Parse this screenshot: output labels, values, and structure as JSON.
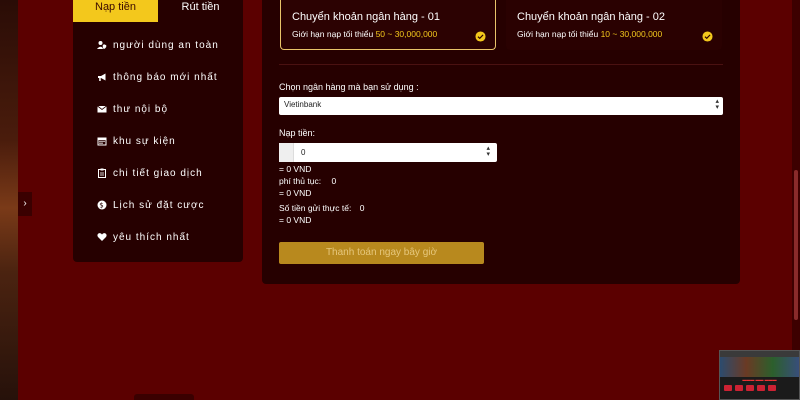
{
  "tabs": {
    "deposit": "Nạp tiền",
    "withdraw": "Rút tiền"
  },
  "sidebar": {
    "items": [
      {
        "label": "người dùng an toàn",
        "icon": "user-shield-icon"
      },
      {
        "label": "thông báo mới nhất",
        "icon": "megaphone-icon"
      },
      {
        "label": "thư nội bộ",
        "icon": "envelope-icon"
      },
      {
        "label": "khu sự kiện",
        "icon": "calendar-icon"
      },
      {
        "label": "chi tiết giao dịch",
        "icon": "clipboard-icon"
      },
      {
        "label": "Lịch sử đặt cược",
        "icon": "coin-icon"
      },
      {
        "label": "yêu thích nhất",
        "icon": "heart-icon"
      }
    ]
  },
  "banks": [
    {
      "title": "Chuyển khoản ngân hàng - 01",
      "limit_label": "Giới hạn nạp tối thiểu",
      "range": "50 ~ 30,000,000"
    },
    {
      "title": "Chuyển khoản ngân hàng - 02",
      "limit_label": "Giới hạn nạp tối thiểu",
      "range": "10 ~ 30,000,000"
    }
  ],
  "form": {
    "bank_select_label": "Chọn ngân hàng mà bạn sử dụng :",
    "bank_select_value": "Vietinbank",
    "amount_label": "Nạp tiền:",
    "amount_value": "0",
    "amount_vnd": "= 0 VND",
    "fee_label": "phí thủ tục:",
    "fee_value": "0",
    "fee_vnd": "= 0 VND",
    "actual_label": "Số tiền gửi thực tế:",
    "actual_value": "0",
    "actual_vnd": "= 0 VND",
    "pay_button": "Thanh toán ngay bây giờ"
  },
  "colors": {
    "background": "#5b0000",
    "panel": "#260000",
    "accent": "#f3c81c",
    "button": "#b8891e"
  }
}
